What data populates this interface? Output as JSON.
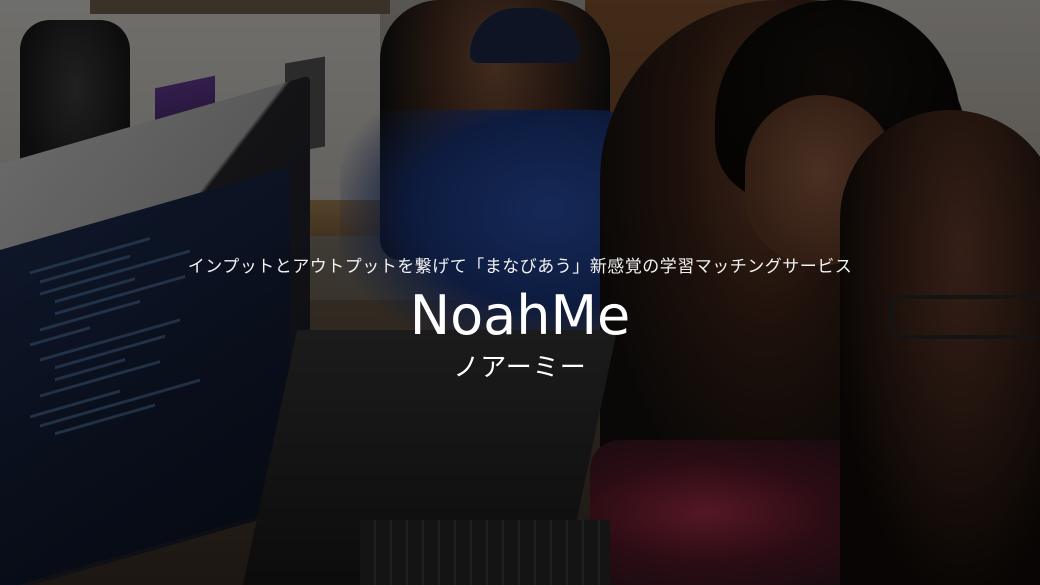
{
  "hero": {
    "tagline": "インプットとアウトプットを繋げて「まなびあう」新感覚の学習マッチングサービス",
    "brand_name": "NoahMe",
    "brand_reading": "ノアーミー"
  },
  "colors": {
    "text": "#ffffff",
    "overlay": "rgba(0,0,0,0.52)"
  }
}
